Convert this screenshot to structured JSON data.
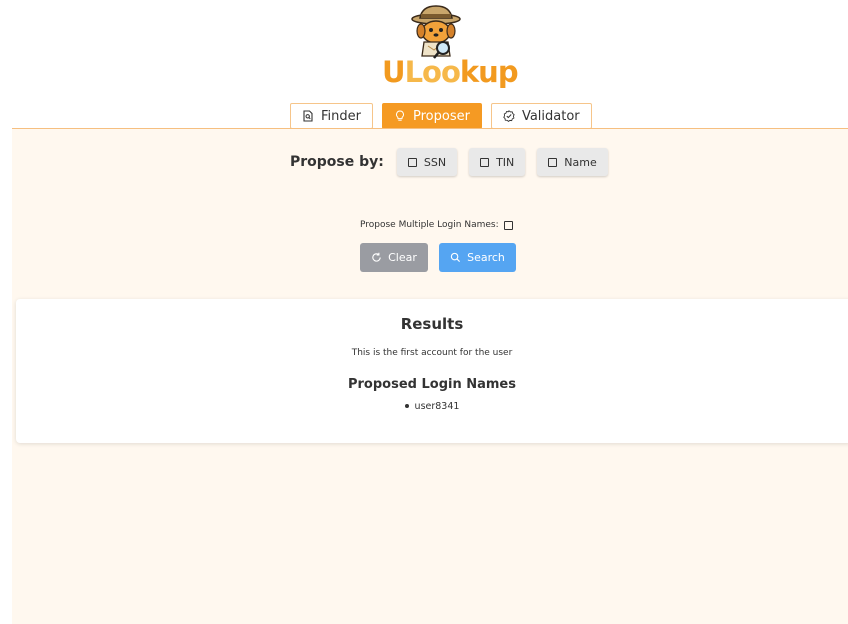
{
  "app": {
    "logo_text_first": "U",
    "logo_text_middle": "Loo",
    "logo_text_last": "kup"
  },
  "tabs": [
    {
      "label": "Finder",
      "icon": "search-file-icon",
      "active": false
    },
    {
      "label": "Proposer",
      "icon": "lightbulb-icon",
      "active": true
    },
    {
      "label": "Validator",
      "icon": "check-badge-icon",
      "active": false
    }
  ],
  "propose": {
    "label": "Propose by:",
    "options": [
      {
        "label": "SSN",
        "checked": false
      },
      {
        "label": "TIN",
        "checked": false
      },
      {
        "label": "Name",
        "checked": false
      }
    ],
    "multiple_label": "Propose Multiple Login Names:",
    "multiple_checked": false
  },
  "actions": {
    "clear_label": "Clear",
    "search_label": "Search"
  },
  "results": {
    "title": "Results",
    "message": "This is the first account for the user",
    "proposed_title": "Proposed Login Names",
    "names": [
      "user8341"
    ]
  },
  "colors": {
    "accent": "#f59a23",
    "search_button": "#55a5f2",
    "clear_button": "#9a9ca2",
    "panel_background": "#fff8ef"
  }
}
